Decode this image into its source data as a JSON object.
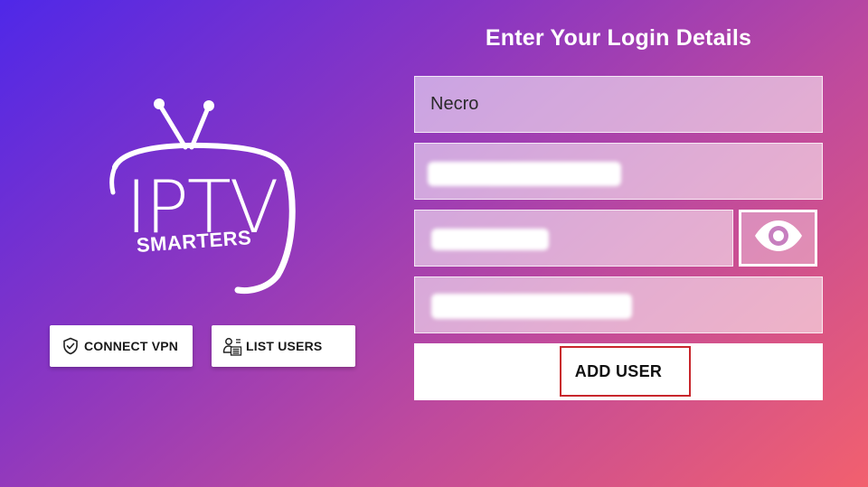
{
  "brand": {
    "logo_main": "IPTV",
    "logo_sub": "SMARTERS"
  },
  "heading": "Enter Your Login Details",
  "form": {
    "name_value": "Necro",
    "username_value": "",
    "password_value": "",
    "url_value": "",
    "add_user_label": "ADD USER"
  },
  "buttons": {
    "connect_vpn": "CONNECT VPN",
    "list_users": "LIST USERS"
  },
  "icons": {
    "vpn": "shield-check-icon",
    "list_users": "user-list-icon",
    "toggle_password": "eye-icon"
  },
  "colors": {
    "gradient_start": "#4f28e8",
    "gradient_end": "#f2606e",
    "focus_border": "#c8262c"
  }
}
